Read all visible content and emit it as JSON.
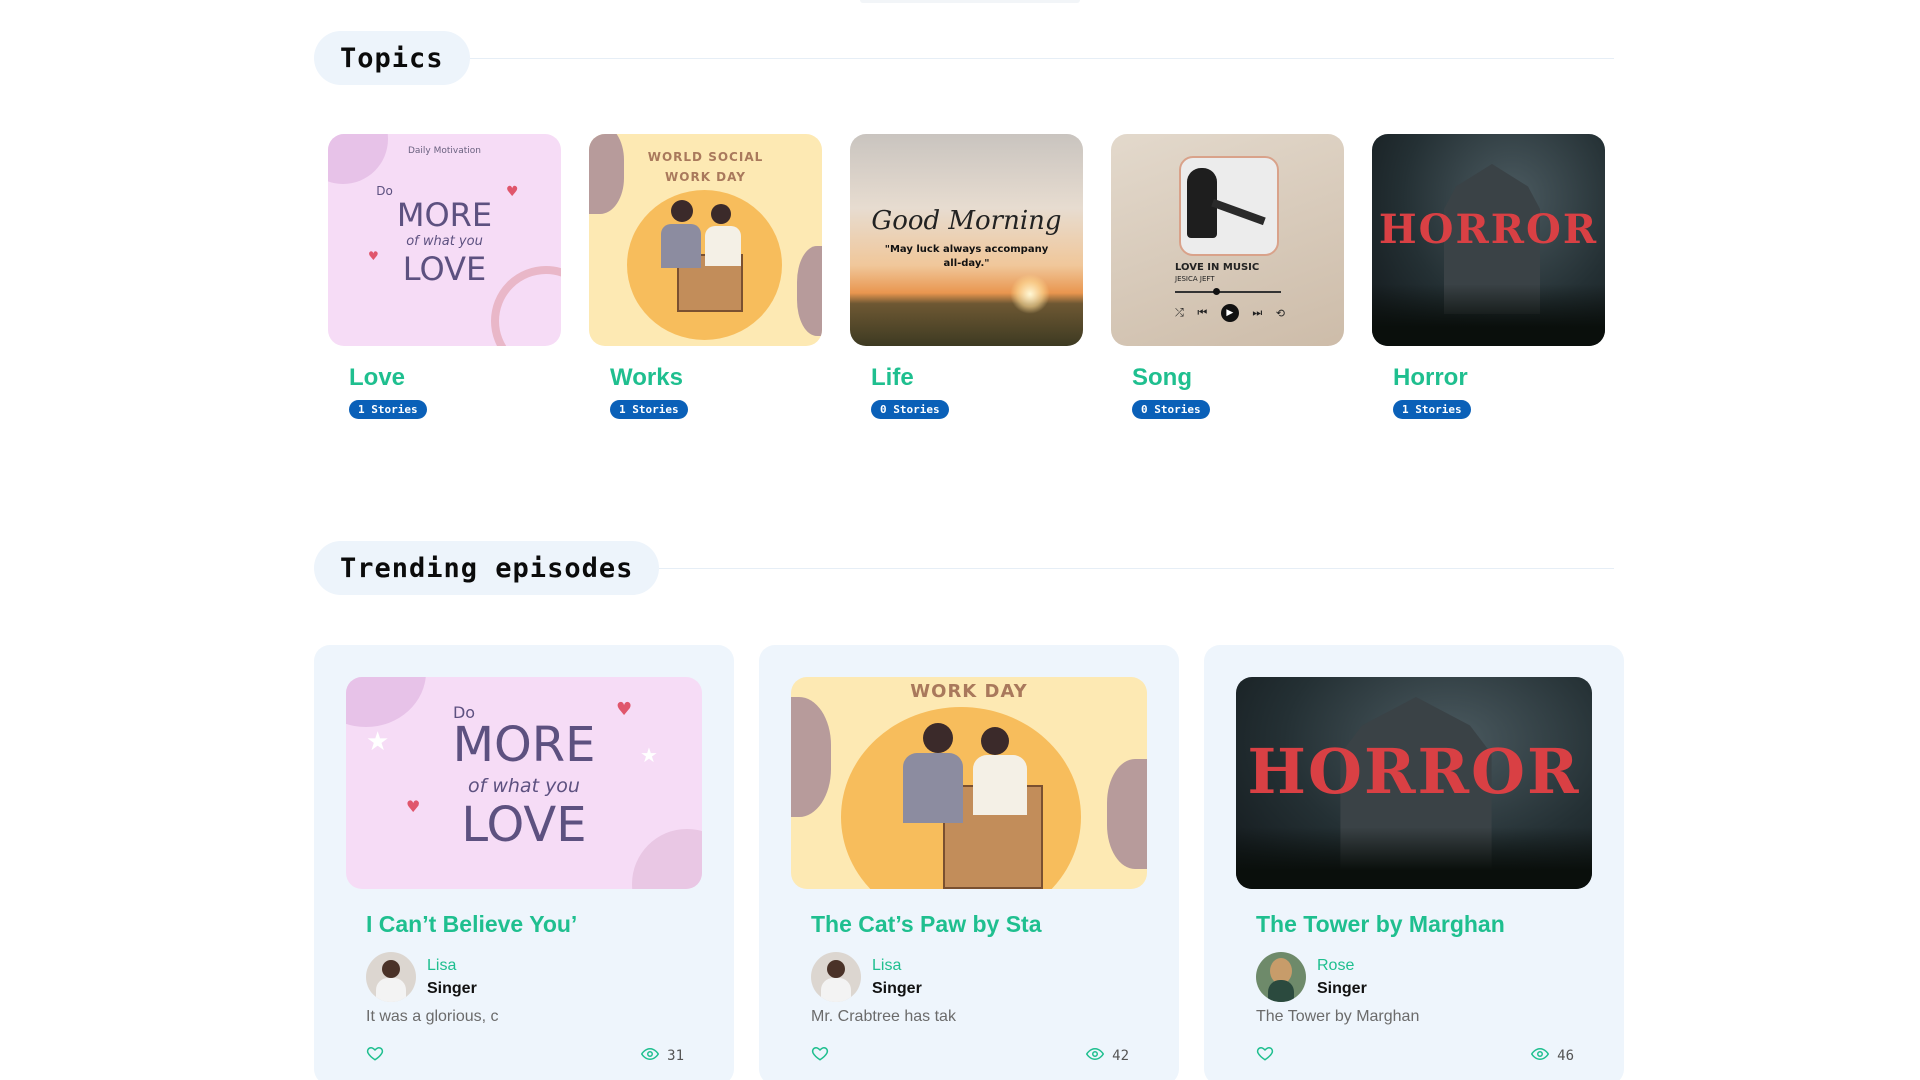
{
  "topics_section": {
    "title": "Topics",
    "items": [
      {
        "name": "Love",
        "badge": "1 Stories",
        "art": {
          "line1": "Daily Motivation",
          "line2": "Do",
          "line3": "MORE",
          "line4": "of what you",
          "line5": "LOVE"
        }
      },
      {
        "name": "Works",
        "badge": "1 Stories",
        "art": {
          "line1": "WORLD SOCIAL",
          "line2": "WORK DAY"
        }
      },
      {
        "name": "Life",
        "badge": "0 Stories",
        "art": {
          "line1": "Good Morning",
          "line2": "\"May luck always accompany",
          "line3": "all-day.\""
        }
      },
      {
        "name": "Song",
        "badge": "0 Stories",
        "art": {
          "line1": "LOVE IN MUSIC",
          "line2": "JESICA JEFT"
        }
      },
      {
        "name": "Horror",
        "badge": "1 Stories",
        "art": {
          "line1": "HORROR"
        }
      }
    ]
  },
  "trending_section": {
    "title": "Trending episodes",
    "items": [
      {
        "title": "I Can’t Believe You’",
        "author": "Lisa",
        "role": "Singer",
        "excerpt": "It was a glorious, c",
        "views": "31",
        "art": {
          "line2": "Do",
          "line3": "MORE",
          "line4": "of what you",
          "line5": "LOVE"
        }
      },
      {
        "title": "The Cat’s Paw by Sta",
        "author": "Lisa",
        "role": "Singer",
        "excerpt": "Mr. Crabtree has tak",
        "views": "42",
        "art": {
          "line2": "WORK DAY"
        }
      },
      {
        "title": "The Tower by Marghan",
        "author": "Rose",
        "role": "Singer",
        "excerpt": "The Tower by Marghan",
        "views": "46",
        "art": {
          "line1": "HORROR"
        }
      }
    ]
  },
  "colors": {
    "accent": "#1fbf8f",
    "badge": "#0a60b8",
    "section_pill": "#edf4fb",
    "card_bg": "#eef5fc"
  },
  "icons": {
    "like": "heart-icon",
    "views": "eye-icon"
  }
}
